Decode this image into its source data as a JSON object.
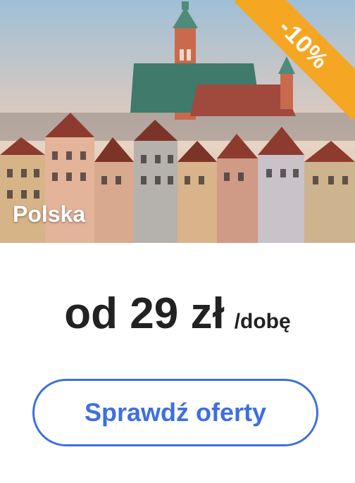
{
  "card": {
    "country": "Polska",
    "discount_badge": "-10%",
    "price_label": "od 29 zł",
    "price_unit": "/dobę",
    "cta_label": "Sprawdź oferty"
  },
  "colors": {
    "accent": "#3d6fe0",
    "badge": "#f5a623",
    "text": "#222222"
  },
  "hero_image": {
    "name": "warsaw-old-town-photo"
  }
}
